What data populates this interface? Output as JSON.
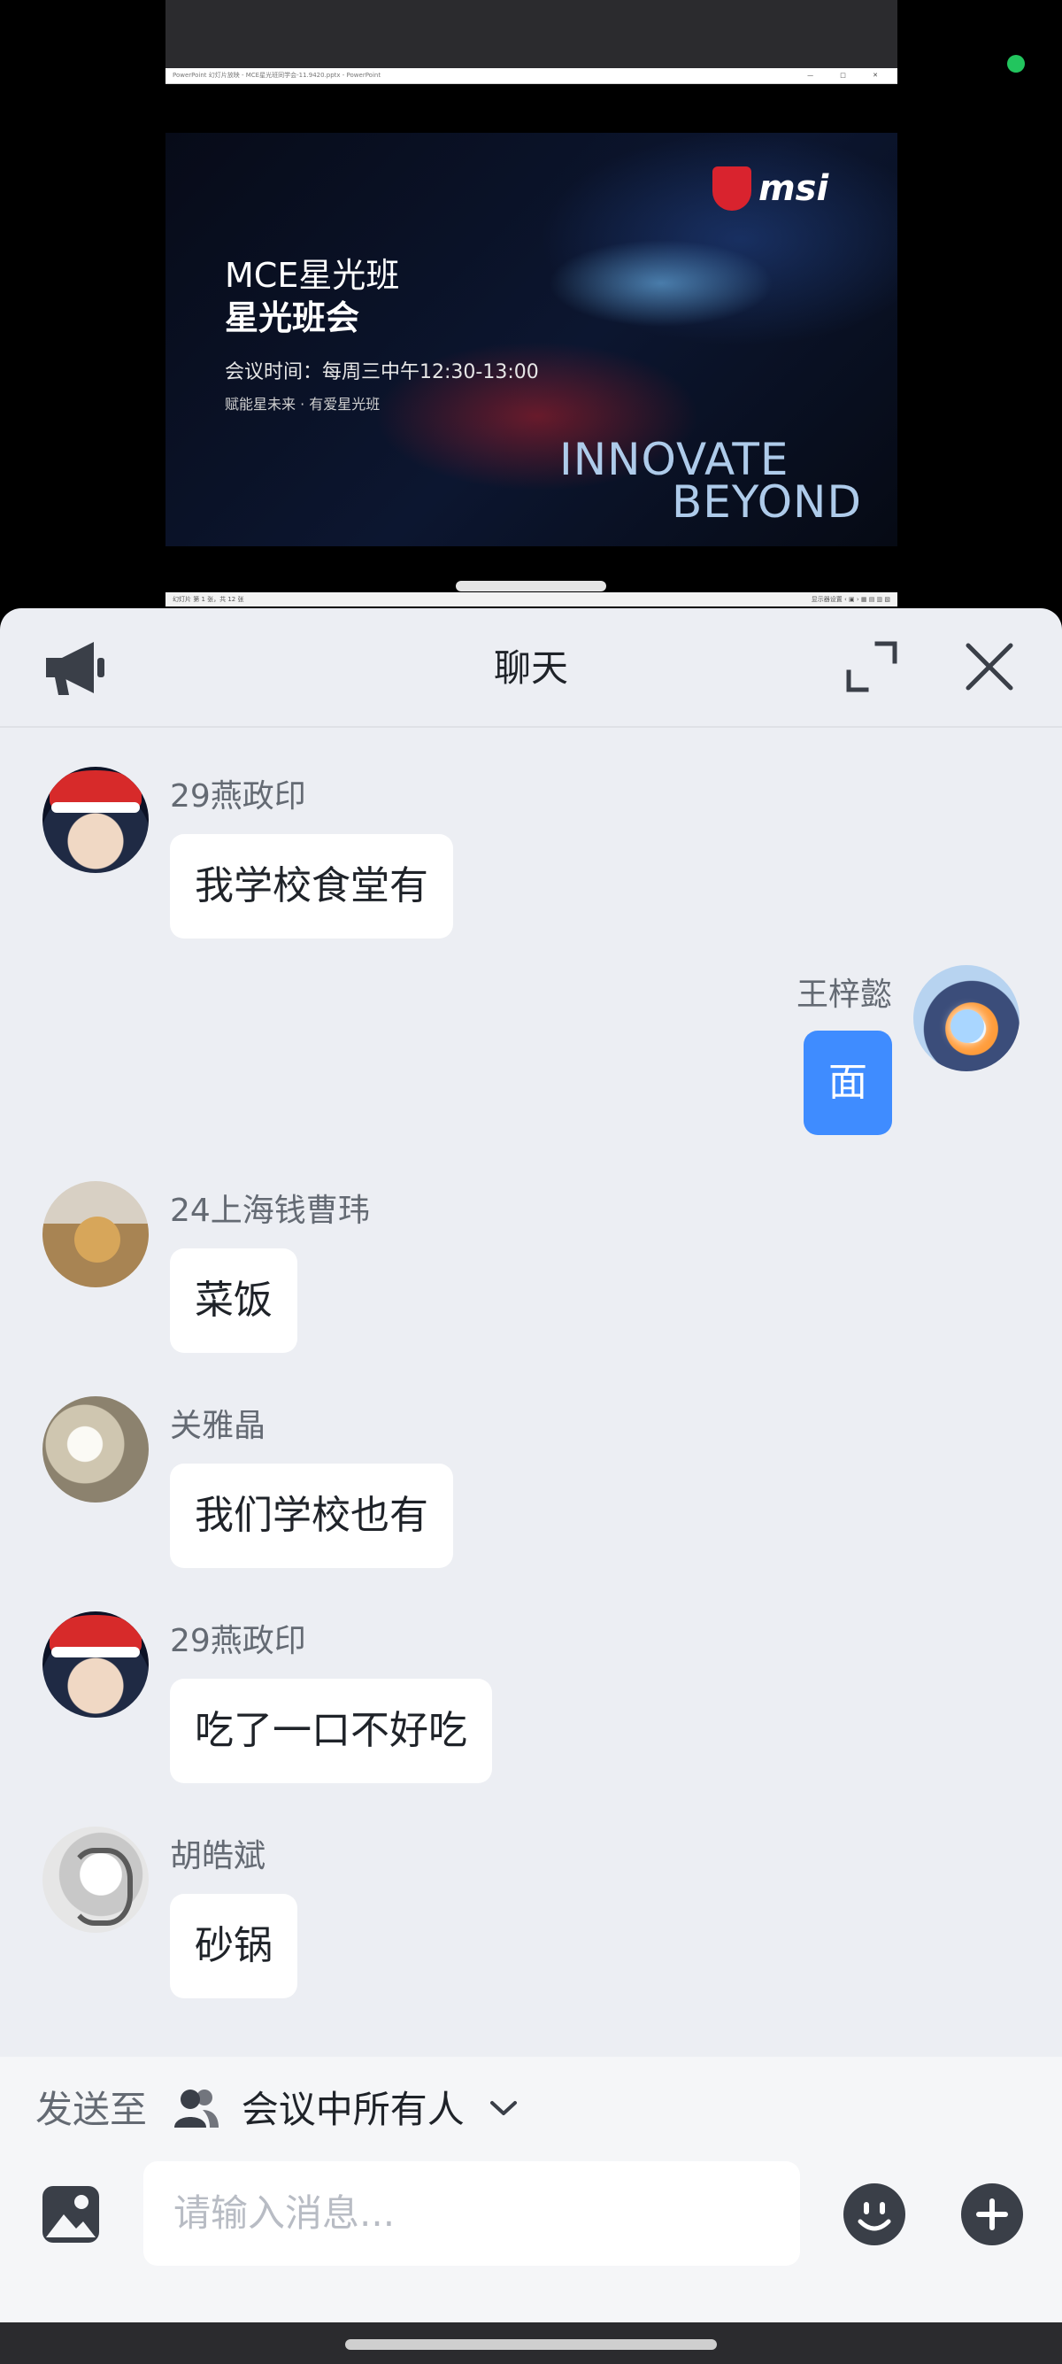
{
  "status": {
    "live_indicator_color": "#22c55e"
  },
  "shared_screen": {
    "window_title": "PowerPoint 幻灯片放映 - MCE星光班同学会-11.9420.pptx - PowerPoint",
    "window_controls": "— □ ✕",
    "slide": {
      "title_line1": "MCE星光班",
      "title_line2": "星光班会",
      "meeting_time": "会议时间：每周三中午12:30-13:00",
      "tagline": "赋能星未来 · 有爱星光班",
      "brand": "msi",
      "slogan_line1": "INNOVATE",
      "slogan_line2": "BEYOND"
    },
    "status_left": "幻灯片 第 1 张，共 12 张",
    "status_right": "显示器设置  ‹  ▣  ›  ▦  ▤  ▥  ▧"
  },
  "chat": {
    "title": "聊天",
    "icons": {
      "announce": "megaphone-icon",
      "expand": "expand-icon",
      "close": "close-icon"
    },
    "messages": [
      {
        "sender": "29燕政印",
        "text": "我学校食堂有",
        "is_me": false,
        "avatar": "santa"
      },
      {
        "sender": "王梓懿",
        "text": "面",
        "is_me": true,
        "avatar": "me"
      },
      {
        "sender": "24上海钱曹玮",
        "text": "菜饭",
        "is_me": false,
        "avatar": "doge"
      },
      {
        "sender": "关雅晶",
        "text": "我们学校也有",
        "is_me": false,
        "avatar": "flower"
      },
      {
        "sender": "29燕政印",
        "text": "吃了一口不好吃",
        "is_me": false,
        "avatar": "santa"
      },
      {
        "sender": "胡皓斌",
        "text": "砂锅",
        "is_me": false,
        "avatar": "sketch"
      }
    ],
    "my_bubble_color": "#3f8cff"
  },
  "composer": {
    "send_to_label": "发送至",
    "recipient": "会议中所有人",
    "input_placeholder": "请输入消息..."
  }
}
